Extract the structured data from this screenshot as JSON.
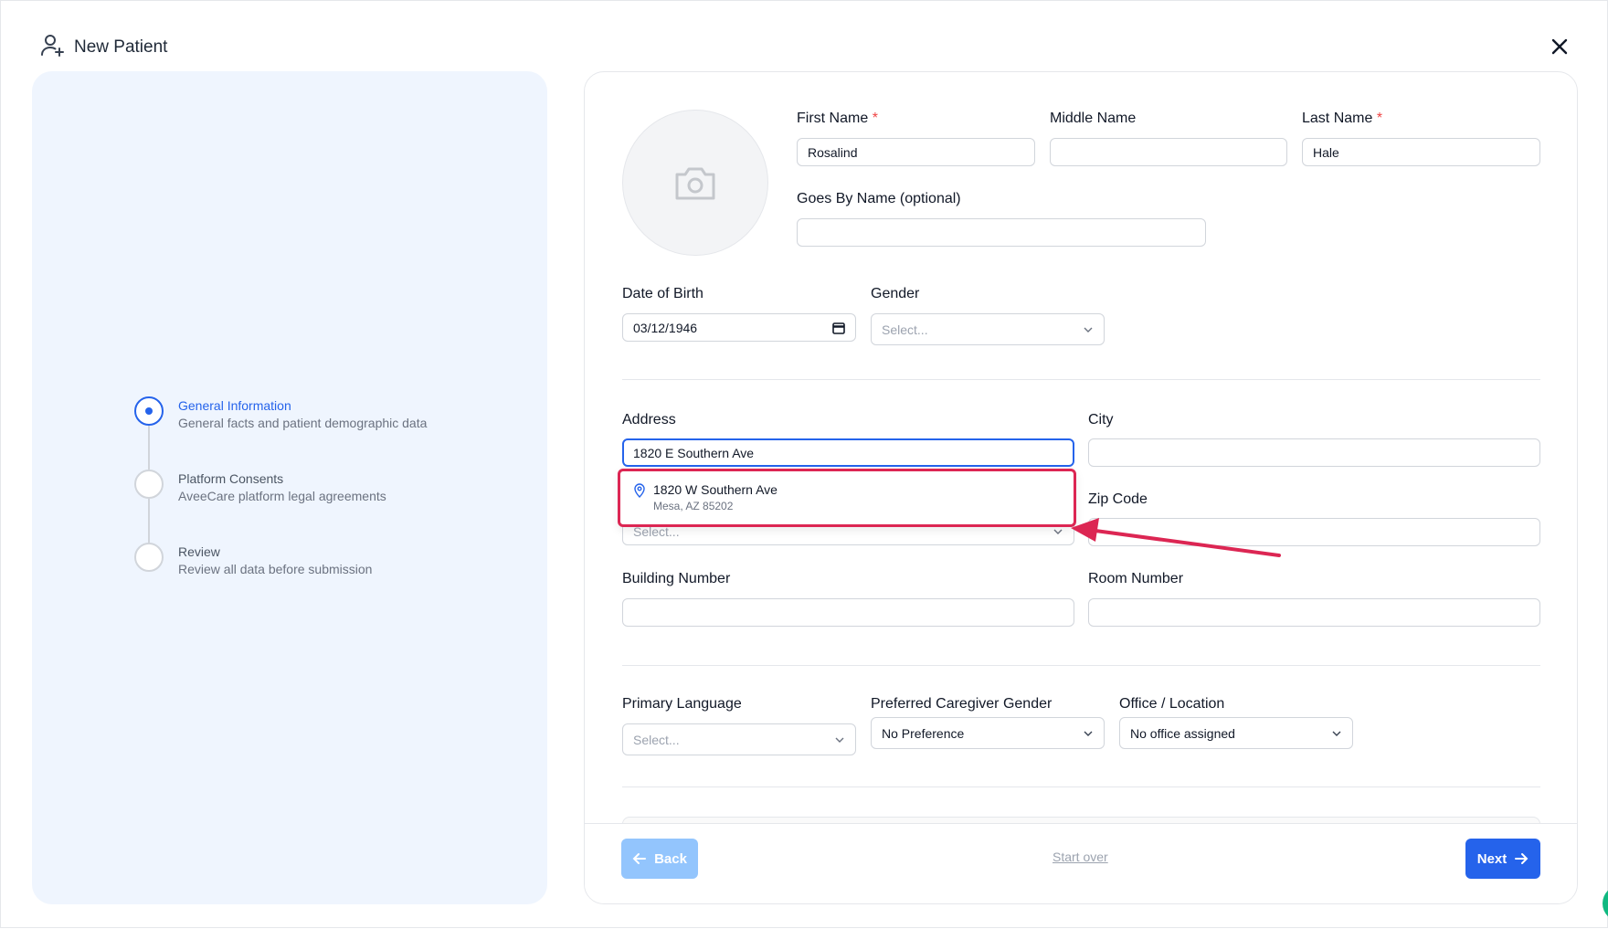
{
  "header": {
    "title": "New Patient"
  },
  "steps": [
    {
      "title": "General Information",
      "subtitle": "General facts and patient demographic data",
      "active": true
    },
    {
      "title": "Platform Consents",
      "subtitle": "AveeCare platform legal agreements",
      "active": false
    },
    {
      "title": "Review",
      "subtitle": "Review all data before submission",
      "active": false
    }
  ],
  "form": {
    "first_name": {
      "label": "First Name",
      "required": "*",
      "value": "Rosalind"
    },
    "middle_name": {
      "label": "Middle Name",
      "value": ""
    },
    "last_name": {
      "label": "Last Name",
      "required": "*",
      "value": "Hale"
    },
    "goes_by": {
      "label": "Goes By Name (optional)",
      "value": ""
    },
    "dob": {
      "label": "Date of Birth",
      "value": "03/12/1946"
    },
    "gender": {
      "label": "Gender",
      "placeholder": "Select..."
    },
    "address": {
      "label": "Address",
      "value": "1820 E Southern Ave"
    },
    "city": {
      "label": "City",
      "value": ""
    },
    "state": {
      "placeholder": "Select..."
    },
    "zip": {
      "label": "Zip Code",
      "value": ""
    },
    "building": {
      "label": "Building Number",
      "value": ""
    },
    "room": {
      "label": "Room Number",
      "value": ""
    },
    "primary_language": {
      "label": "Primary Language",
      "placeholder": "Select..."
    },
    "caregiver_gender": {
      "label": "Preferred Caregiver Gender",
      "value": "No Preference"
    },
    "office": {
      "label": "Office / Location",
      "value": "No office assigned"
    }
  },
  "suggestion": {
    "street": "1820 W Southern Ave",
    "locality": "Mesa, AZ 85202"
  },
  "footer": {
    "back_label": "Back",
    "start_over_label": "Start over",
    "next_label": "Next"
  },
  "colors": {
    "accent": "#2563eb",
    "highlight": "#dc2653",
    "panel": "#eff5fe"
  },
  "icons": {
    "header": "user-plus-icon",
    "close": "close-icon",
    "avatar": "camera-icon",
    "suggestion": "map-pin-icon",
    "date": "calendar-icon",
    "select": "chevron-down-icon"
  }
}
